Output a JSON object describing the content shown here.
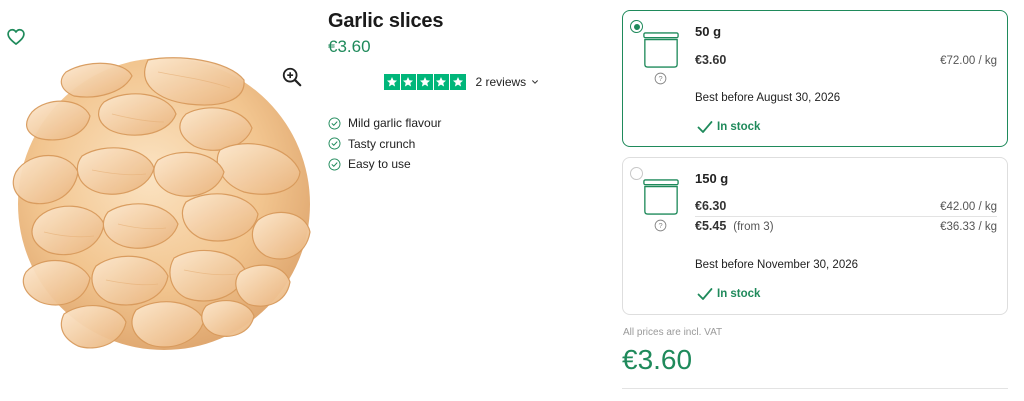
{
  "product": {
    "title": "Garlic slices",
    "price": "€3.60"
  },
  "rating": {
    "stars": 5,
    "reviews_label": "2 reviews"
  },
  "features": [
    "Mild garlic flavour",
    "Tasty crunch",
    "Easy to use"
  ],
  "variants": [
    {
      "weight": "50 g",
      "price": "€3.60",
      "unit_price": "€72.00 / kg",
      "best_before": "Best before August 30, 2026",
      "stock": "In stock",
      "selected": true
    },
    {
      "weight": "150 g",
      "price": "€6.30",
      "unit_price": "€42.00 / kg",
      "bulk_price": "€5.45",
      "bulk_note": "(from 3)",
      "bulk_unit_price": "€36.33 / kg",
      "best_before": "Best before November 30, 2026",
      "stock": "In stock",
      "selected": false
    }
  ],
  "summary": {
    "vat_note": "All prices are incl. VAT",
    "total_price": "€3.60"
  },
  "colors": {
    "accent": "#1f8a5b",
    "trustpilot": "#00b67a"
  },
  "icons": [
    "heart-icon",
    "zoom-in-icon",
    "star-icon",
    "chevron-down-icon",
    "check-circle-icon",
    "jar-icon",
    "help-icon",
    "checkmark-icon"
  ]
}
